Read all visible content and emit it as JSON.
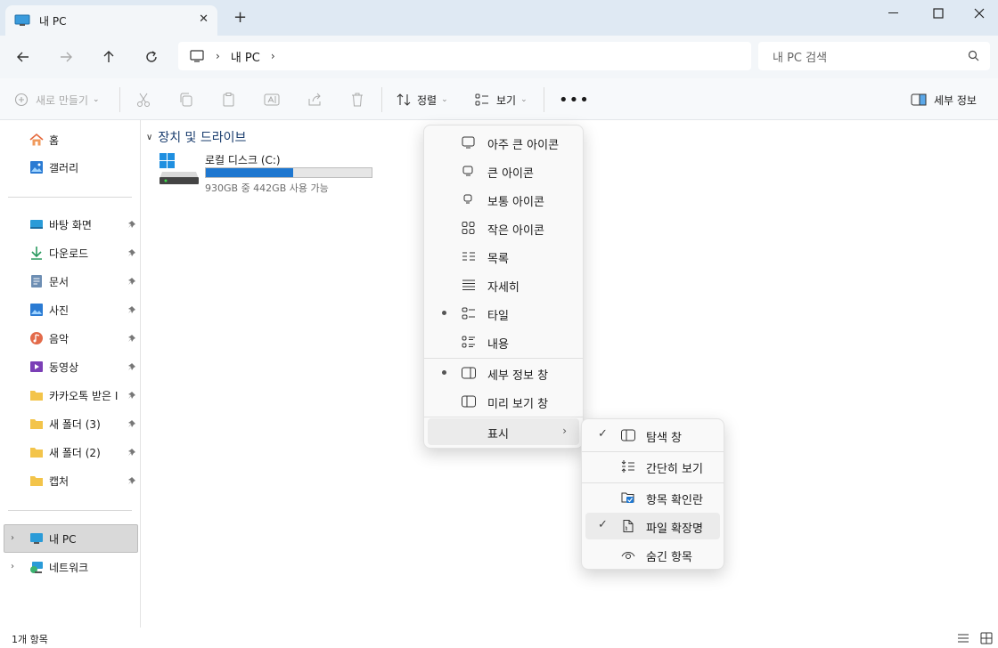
{
  "tab": {
    "title": "내 PC"
  },
  "address": {
    "crumb": "내 PC"
  },
  "search": {
    "placeholder": "내 PC 검색"
  },
  "commands": {
    "new": "새로 만들기",
    "sort": "정렬",
    "view": "보기",
    "details": "세부 정보"
  },
  "sidebar": {
    "home": "홈",
    "gallery": "갤러리",
    "pinned": [
      "바탕 화면",
      "다운로드",
      "문서",
      "사진",
      "음악",
      "동영상",
      "카카오톡 받은 I",
      "새 폴더 (3)",
      "새 폴더 (2)",
      "캡처"
    ],
    "this_pc": "내 PC",
    "network": "네트워크"
  },
  "content": {
    "group": "장치 및 드라이브",
    "drive_name": "로컬 디스크 (C:)",
    "drive_info": "930GB 중 442GB 사용 가능",
    "drive_used_fraction": 0.525
  },
  "status": {
    "count": "1개 항목"
  },
  "view_menu": {
    "items": [
      "아주 큰 아이콘",
      "큰 아이콘",
      "보통 아이콘",
      "작은 아이콘",
      "목록",
      "자세히",
      "타일",
      "내용"
    ],
    "panes": [
      "세부 정보 창",
      "미리 보기 창"
    ],
    "show": "표시"
  },
  "show_menu": {
    "items": [
      "탐색 창",
      "간단히 보기",
      "항목 확인란",
      "파일 확장명",
      "숨긴 항목"
    ]
  },
  "colors": {
    "accent": "#1e77d0",
    "titlebar": "#dfe9f3",
    "folder": "#f3c44a"
  }
}
